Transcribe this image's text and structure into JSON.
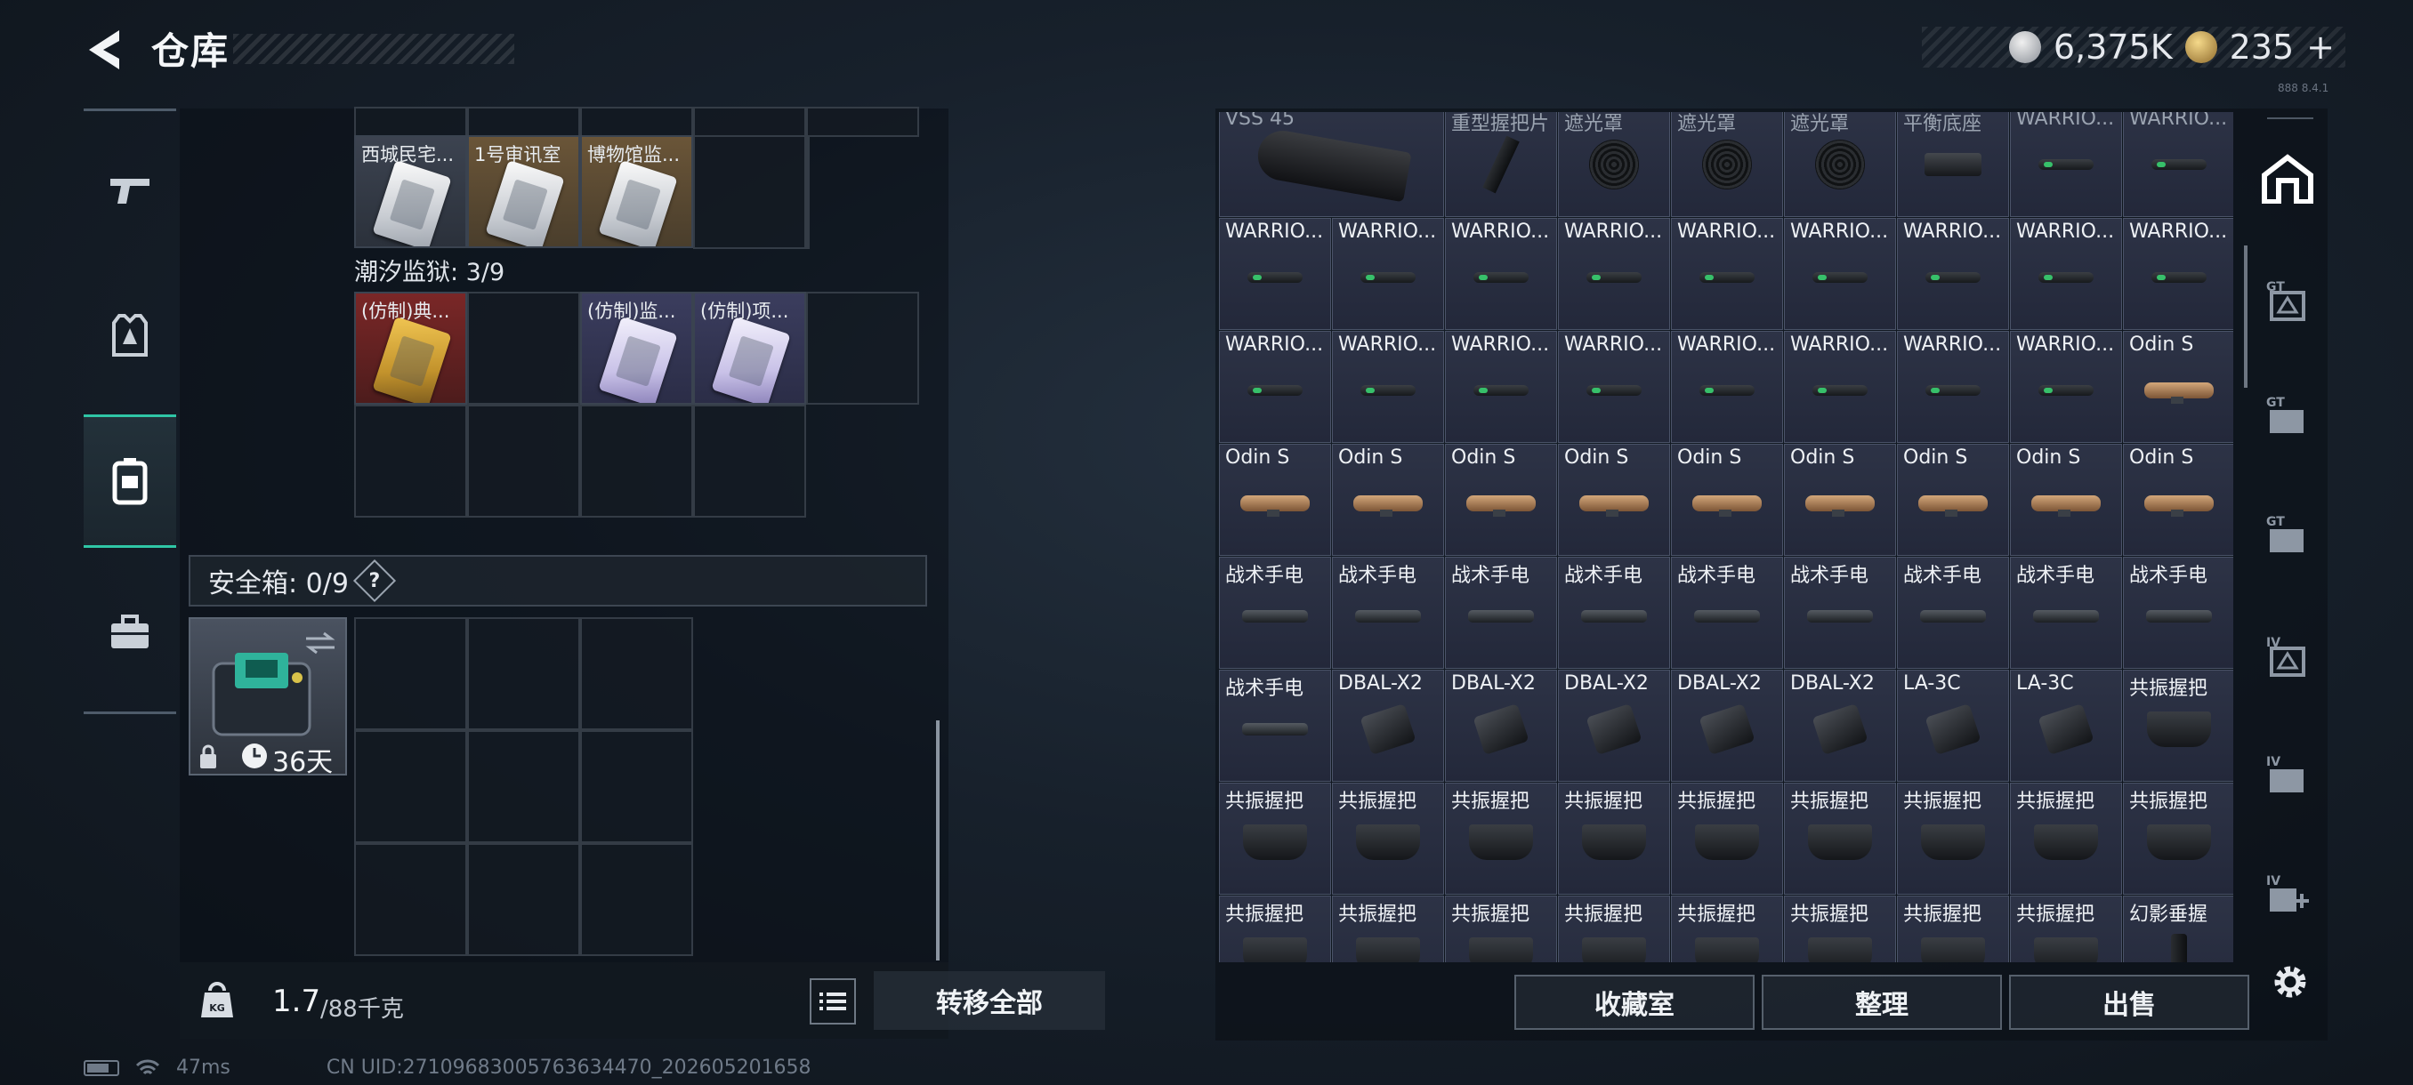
{
  "header": {
    "title": "仓库",
    "currency_silver": "6,375K",
    "currency_gold": "235",
    "currency_plus": "+",
    "version_text": "888 8.4.1"
  },
  "left_panel": {
    "row1_items": [
      {
        "label": "西城民宅...",
        "rarity": "gray"
      },
      {
        "label": "1号审讯室",
        "rarity": "gold"
      },
      {
        "label": "博物馆监...",
        "rarity": "gold"
      }
    ],
    "prison_label": "潮汐监狱: 3/9",
    "prison_items": [
      {
        "label": "(仿制)典...",
        "rarity": "red",
        "col": 0
      },
      {
        "label": "(仿制)监...",
        "rarity": "purple",
        "col": 2
      },
      {
        "label": "(仿制)项...",
        "rarity": "purple",
        "col": 3
      }
    ],
    "safe_label": "安全箱: 0/9",
    "safe_help": "?",
    "safebox_days": "36天",
    "weight_value": "1.7",
    "weight_max": "/88千克",
    "transfer_all": "转移全部"
  },
  "right_panel": {
    "items": [
      {
        "label": "VSS 45",
        "icon": "mag",
        "dim": true
      },
      {
        "label": "",
        "icon": "none"
      },
      {
        "label": "重型握把片",
        "icon": "plate",
        "dim": true
      },
      {
        "label": "遮光罩",
        "icon": "hood",
        "dim": true
      },
      {
        "label": "遮光罩",
        "icon": "hood",
        "dim": true
      },
      {
        "label": "遮光罩",
        "icon": "hood",
        "dim": true
      },
      {
        "label": "平衡底座",
        "icon": "base",
        "dim": true
      },
      {
        "label": "WARRIO...",
        "icon": "warrior",
        "dim": true
      },
      {
        "label": "WARRIO...",
        "icon": "warrior",
        "dim": true
      },
      {
        "label": "WARRIO...",
        "icon": "warrior"
      },
      {
        "label": "WARRIO...",
        "icon": "warrior"
      },
      {
        "label": "WARRIO...",
        "icon": "warrior"
      },
      {
        "label": "WARRIO...",
        "icon": "warrior"
      },
      {
        "label": "WARRIO...",
        "icon": "warrior"
      },
      {
        "label": "WARRIO...",
        "icon": "warrior"
      },
      {
        "label": "WARRIO...",
        "icon": "warrior"
      },
      {
        "label": "WARRIO...",
        "icon": "warrior"
      },
      {
        "label": "WARRIO...",
        "icon": "warrior"
      },
      {
        "label": "WARRIO...",
        "icon": "warrior"
      },
      {
        "label": "WARRIO...",
        "icon": "warrior"
      },
      {
        "label": "WARRIO...",
        "icon": "warrior"
      },
      {
        "label": "WARRIO...",
        "icon": "warrior"
      },
      {
        "label": "WARRIO...",
        "icon": "warrior"
      },
      {
        "label": "WARRIO...",
        "icon": "warrior"
      },
      {
        "label": "WARRIO...",
        "icon": "warrior"
      },
      {
        "label": "WARRIO...",
        "icon": "warrior"
      },
      {
        "label": "Odin S",
        "icon": "odin"
      },
      {
        "label": "Odin S",
        "icon": "odin"
      },
      {
        "label": "Odin S",
        "icon": "odin"
      },
      {
        "label": "Odin S",
        "icon": "odin"
      },
      {
        "label": "Odin S",
        "icon": "odin"
      },
      {
        "label": "Odin S",
        "icon": "odin"
      },
      {
        "label": "Odin S",
        "icon": "odin"
      },
      {
        "label": "Odin S",
        "icon": "odin"
      },
      {
        "label": "Odin S",
        "icon": "odin"
      },
      {
        "label": "Odin S",
        "icon": "odin"
      },
      {
        "label": "战术手电",
        "icon": "torch"
      },
      {
        "label": "战术手电",
        "icon": "torch"
      },
      {
        "label": "战术手电",
        "icon": "torch"
      },
      {
        "label": "战术手电",
        "icon": "torch"
      },
      {
        "label": "战术手电",
        "icon": "torch"
      },
      {
        "label": "战术手电",
        "icon": "torch"
      },
      {
        "label": "战术手电",
        "icon": "torch"
      },
      {
        "label": "战术手电",
        "icon": "torch"
      },
      {
        "label": "战术手电",
        "icon": "torch"
      },
      {
        "label": "战术手电",
        "icon": "torch"
      },
      {
        "label": "DBAL-X2",
        "icon": "dbal"
      },
      {
        "label": "DBAL-X2",
        "icon": "dbal"
      },
      {
        "label": "DBAL-X2",
        "icon": "dbal"
      },
      {
        "label": "DBAL-X2",
        "icon": "dbal"
      },
      {
        "label": "DBAL-X2",
        "icon": "dbal"
      },
      {
        "label": "LA-3C",
        "icon": "dbal"
      },
      {
        "label": "LA-3C",
        "icon": "dbal"
      },
      {
        "label": "共振握把",
        "icon": "grip"
      },
      {
        "label": "共振握把",
        "icon": "grip"
      },
      {
        "label": "共振握把",
        "icon": "grip"
      },
      {
        "label": "共振握把",
        "icon": "grip"
      },
      {
        "label": "共振握把",
        "icon": "grip"
      },
      {
        "label": "共振握把",
        "icon": "grip"
      },
      {
        "label": "共振握把",
        "icon": "grip"
      },
      {
        "label": "共振握把",
        "icon": "grip"
      },
      {
        "label": "共振握把",
        "icon": "grip"
      },
      {
        "label": "共振握把",
        "icon": "grip"
      },
      {
        "label": "共振握把",
        "icon": "grip"
      },
      {
        "label": "共振握把",
        "icon": "grip"
      },
      {
        "label": "共振握把",
        "icon": "grip"
      },
      {
        "label": "共振握把",
        "icon": "grip"
      },
      {
        "label": "共振握把",
        "icon": "grip"
      },
      {
        "label": "共振握把",
        "icon": "grip"
      },
      {
        "label": "共振握把",
        "icon": "grip"
      },
      {
        "label": "共振握把",
        "icon": "grip"
      },
      {
        "label": "幻影垂握",
        "icon": "phantom"
      }
    ],
    "buttons": {
      "collection": "收藏室",
      "sort": "整理",
      "sell": "出售"
    }
  },
  "status": {
    "ping": "47ms",
    "uid": "CN UID:27109683005763634470_202605201658"
  },
  "colors": {
    "accent": "#2fc6a6",
    "gold_rarity": "#6a5538",
    "red_rarity": "#7a2727",
    "purple_rarity": "#3b3d5e"
  }
}
